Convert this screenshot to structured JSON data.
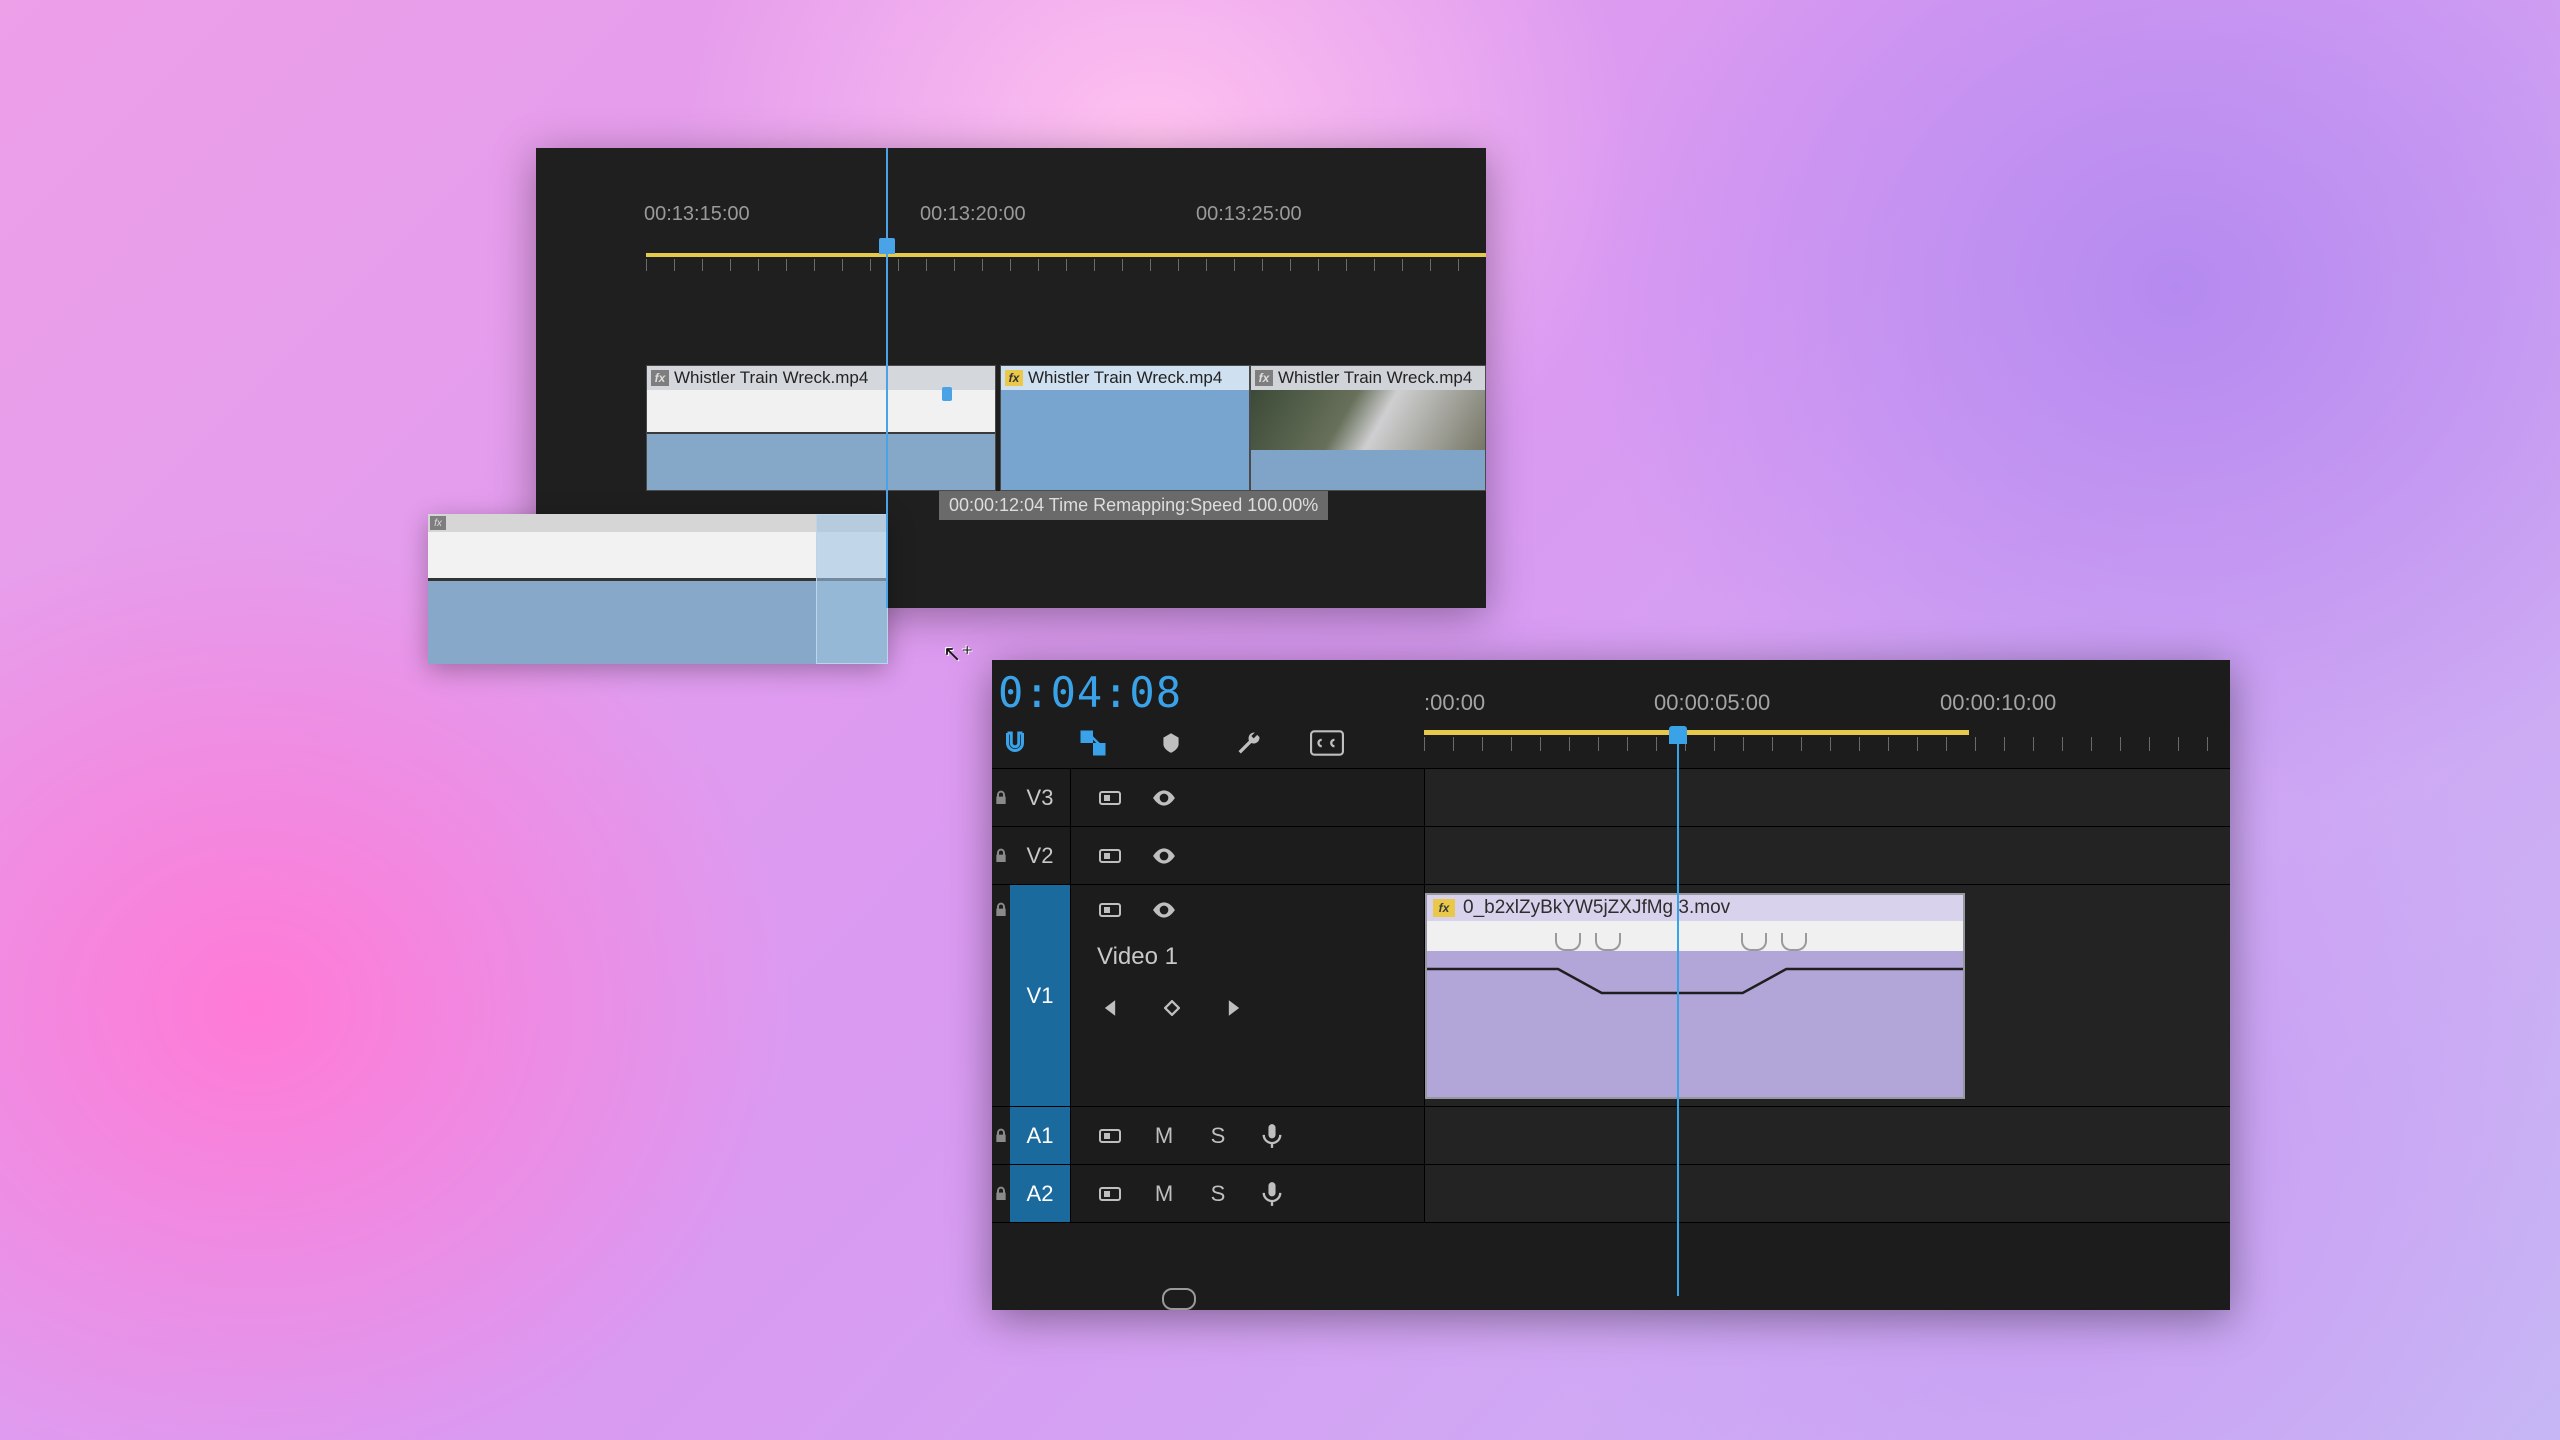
{
  "panel1": {
    "ruler_labels": [
      "00:13:15:00",
      "00:13:20:00",
      "00:13:25:00"
    ],
    "clips": [
      {
        "name": "Whistler Train Wreck.mp4",
        "fx": "grey"
      },
      {
        "name": "Whistler Train Wreck.mp4",
        "fx": "yellow"
      },
      {
        "name": "Whistler Train Wreck.mp4",
        "fx": "grey"
      }
    ],
    "tooltip": "00:00:12:04  Time Remapping:Speed  100.00%"
  },
  "panel2": {
    "timecode": "0:04:08",
    "ruler_labels": [
      ":00:00",
      "00:00:05:00",
      "00:00:10:00"
    ],
    "tracks": {
      "v3": "V3",
      "v2": "V2",
      "v1": "V1",
      "v1_name": "Video 1",
      "a1": "A1",
      "a2": "A2",
      "mute": "M",
      "solo": "S"
    },
    "clip": {
      "name": "0_b2xlZyBkYW5jZXJfMg 3.mov"
    }
  }
}
